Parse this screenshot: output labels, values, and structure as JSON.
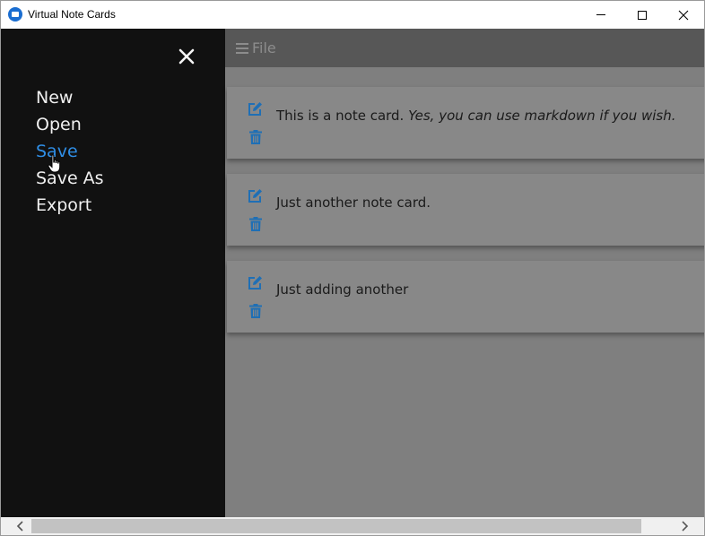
{
  "window": {
    "title": "Virtual Note Cards"
  },
  "sidebar": {
    "items": [
      {
        "label": "New"
      },
      {
        "label": "Open"
      },
      {
        "label": "Save",
        "active": true
      },
      {
        "label": "Save As"
      },
      {
        "label": "Export"
      }
    ]
  },
  "topbar": {
    "file_label": "File"
  },
  "cards": [
    {
      "text": "This is a note card. ",
      "emphasis": "Yes, you can use markdown if you wish."
    },
    {
      "text": "Just another note card.",
      "emphasis": ""
    },
    {
      "text": "Just adding another",
      "emphasis": ""
    }
  ],
  "icons": {
    "close": "close-icon",
    "edit": "edit-icon",
    "delete": "trash-icon",
    "menu": "hamburger-icon",
    "cursor": "hand-pointer-icon"
  },
  "colors": {
    "accent": "#2f8ee6",
    "icon_blue": "#1f6fb5",
    "sidebar_bg": "#111111",
    "topbar_bg": "#575757",
    "card_bg": "#888888"
  }
}
